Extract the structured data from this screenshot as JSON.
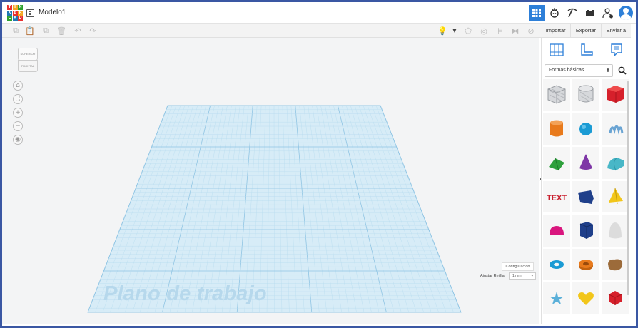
{
  "app": {
    "logo_letters": [
      "T",
      "I",
      "N",
      "K",
      "E",
      "R",
      "C",
      "A",
      "D"
    ],
    "logo_colors": [
      "#e8312f",
      "#f5a623",
      "#2ca02c",
      "#1f77b4",
      "#e8312f",
      "#f5a623",
      "#2ca02c",
      "#1f77b4",
      "#e8312f"
    ],
    "title": "Modelo1",
    "accent": "#2d7fd8",
    "frame_color": "#3a57a3"
  },
  "top_right_buttons": [
    {
      "name": "grid-view-button",
      "icon": "grid-icon",
      "glyph": "▦",
      "active": true
    },
    {
      "name": "tinkerers-button",
      "icon": "tinker-icon",
      "glyph": "⚙",
      "active": false
    },
    {
      "name": "build-button",
      "icon": "pickaxe-icon",
      "glyph": "⛏",
      "active": false
    },
    {
      "name": "bricks-button",
      "icon": "bricks-icon",
      "glyph": "▟",
      "active": false
    },
    {
      "name": "add-user-button",
      "icon": "add-user-icon",
      "glyph": "👤",
      "active": false
    }
  ],
  "toolbar": {
    "left_icons": [
      "copy-icon",
      "paste-icon",
      "duplicate-icon",
      "delete-icon",
      "undo-icon",
      "redo-icon"
    ],
    "right_icons": [
      "light-bulb-icon",
      "dropdown-icon",
      "group-icon",
      "ungroup-icon",
      "align-icon",
      "mirror-icon",
      "workplane-icon"
    ]
  },
  "actions": {
    "import_label": "Importar",
    "export_label": "Exportar",
    "send_label": "Enviar a"
  },
  "viewcube": {
    "top_label": "SUPERIOR",
    "front_label": "FRONTAL"
  },
  "canvas": {
    "workplane_label": "Plano de trabajo",
    "config_label": "Configuración",
    "grid_label": "Ajustar Rejilla",
    "grid_value": "1 mm",
    "plane_color": "#b6d8ec"
  },
  "panel": {
    "library_value": "Formas básicas",
    "tools": [
      "workplane-tool-icon",
      "ruler-tool-icon",
      "notes-tool-icon"
    ],
    "shapes": [
      {
        "name": "hole-box",
        "color": "#b9bcc1"
      },
      {
        "name": "hole-cylinder",
        "color": "#b9bcc1"
      },
      {
        "name": "box",
        "color": "#d6202b"
      },
      {
        "name": "cylinder",
        "color": "#e87a1c"
      },
      {
        "name": "sphere",
        "color": "#1b9bd4"
      },
      {
        "name": "scribble",
        "color": "#6aa4d3"
      },
      {
        "name": "roof",
        "color": "#2ea03c"
      },
      {
        "name": "cone",
        "color": "#7e36a6"
      },
      {
        "name": "round-roof",
        "color": "#48b7c7"
      },
      {
        "name": "text",
        "color": "#c81d2c"
      },
      {
        "name": "wedge",
        "color": "#1f3f8a"
      },
      {
        "name": "pyramid",
        "color": "#f2c61a"
      },
      {
        "name": "half-sphere",
        "color": "#d9167e"
      },
      {
        "name": "polygon",
        "color": "#1f3f8a"
      },
      {
        "name": "paraboloid",
        "color": "#c9c9c9"
      },
      {
        "name": "torus",
        "color": "#1b9bd4"
      },
      {
        "name": "tube",
        "color": "#e87a1c"
      },
      {
        "name": "shape-generator",
        "color": "#9c6b3a"
      },
      {
        "name": "star",
        "color": "#5bb0d9"
      },
      {
        "name": "heart",
        "color": "#f2c61a"
      },
      {
        "name": "icosahedron",
        "color": "#d6202b"
      }
    ]
  }
}
